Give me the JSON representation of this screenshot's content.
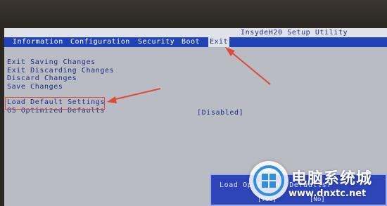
{
  "bios": {
    "title": "InsydeH20 Setup Utility",
    "tabs": [
      {
        "label": "Information"
      },
      {
        "label": "Configuration"
      },
      {
        "label": "Security"
      },
      {
        "label": "Boot"
      },
      {
        "label": "Exit",
        "active": true
      }
    ],
    "exit_items": [
      {
        "label": "Exit Saving Changes"
      },
      {
        "label": "Exit Discarding Changes"
      },
      {
        "label": "Discard Changes"
      },
      {
        "label": "Save Changes"
      },
      {
        "label": "Load Default Settings"
      },
      {
        "label": "OS Optimized Defaults",
        "value": "[Disabled]"
      }
    ],
    "dialog": {
      "title": "Load Optimized Defaults?",
      "yes": "[Yes]",
      "no": "[No]"
    }
  },
  "watermark": {
    "text": "电脑系统城",
    "url": "www.dnxtc.net"
  },
  "colors": {
    "menu_bar": "#2243b8",
    "text": "#1d2e86",
    "screen_bg": "#b9bcc3",
    "annotation": "#e04a3a"
  }
}
